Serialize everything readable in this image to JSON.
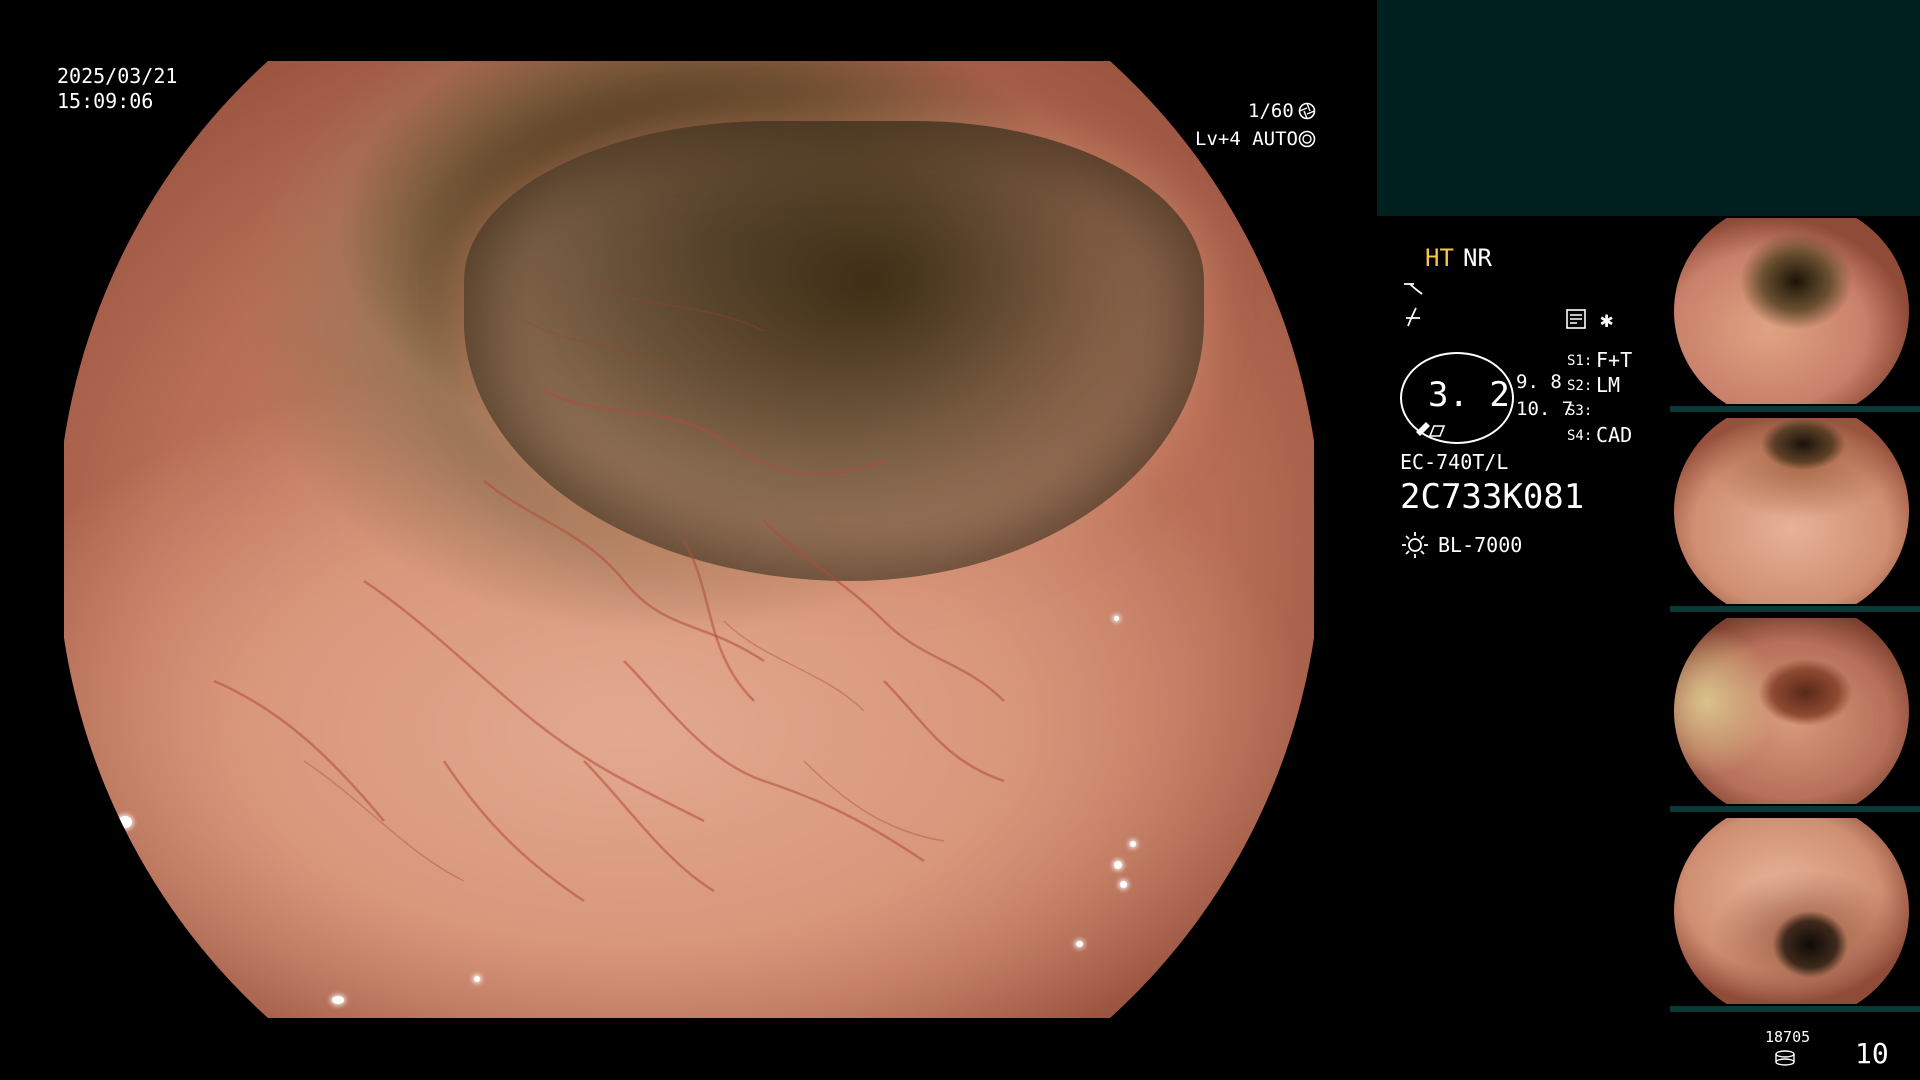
{
  "overlay": {
    "date": "2025/03/21",
    "time": "15:09:06",
    "shutter": "1/60",
    "level": "Lv+4 AUTO"
  },
  "settings": {
    "mode_ht": "HT",
    "mode_nr": "NR",
    "enhancement": "3. 2",
    "enh_top": "9. 8",
    "enh_bottom": "10. 7",
    "switches": [
      {
        "key": "S1:",
        "value": "F+T"
      },
      {
        "key": "S2:",
        "value": "LM"
      },
      {
        "key": "S3:",
        "value": ""
      },
      {
        "key": "S4:",
        "value": "CAD"
      }
    ],
    "scope_model": "EC-740T/L",
    "scope_serial": "2C733K081",
    "light_source": "BL-7000"
  },
  "captures": {
    "count_small": "18705",
    "count_big": "10"
  },
  "icons": {
    "shutter": "aperture-icon",
    "level": "iris-icon",
    "tone": "tone-curve-icon",
    "freeze": "freeze-icon",
    "memory": "memory-card-icon",
    "star": "asterisk-icon",
    "light": "lamp-icon",
    "storage": "storage-drum-icon"
  },
  "colors": {
    "ht_highlight": "#f2c84b",
    "panel_teal": "#001f1f"
  }
}
